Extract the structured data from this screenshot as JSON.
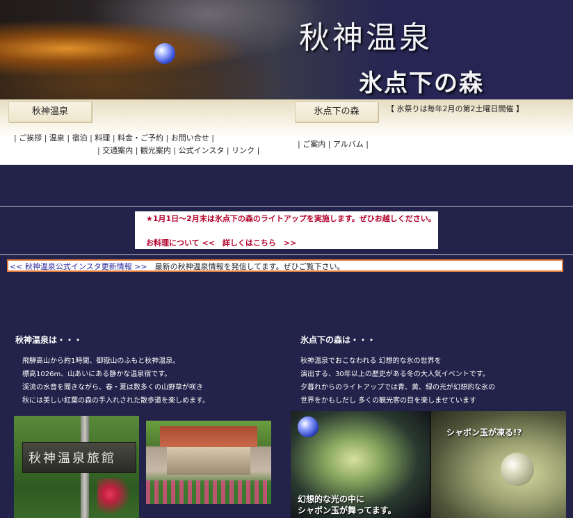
{
  "header": {
    "title_main": "秋神温泉",
    "title_sub": "氷点下の森"
  },
  "nav": {
    "tab_akigami": "秋神温泉",
    "tab_hyoten": "氷点下の森",
    "festival_note": "【 氷祭りは毎年2月の第2土曜日開催 】",
    "akigami_links_row1": [
      "ご挨拶",
      "温泉",
      "宿泊",
      "料理",
      "料金・ご予約",
      "お問い合せ"
    ],
    "akigami_links_row2": [
      "交通案内",
      "観光案内",
      "公式インスタ",
      "リンク"
    ],
    "hyoten_links": [
      "ご案内",
      "アルバム"
    ]
  },
  "notice": {
    "line1": "★1月1日～2月末は氷点下の森のライトアップを実施します。ぜひお越しください。",
    "line2": "お料理について <<　詳しくはこちら　>>"
  },
  "insta": {
    "link": "<< 秋神温泉公式インスタ更新情報 >>",
    "text": "　最新の秋神温泉情報を発信してます。ぜひご覧下さい。"
  },
  "akigami_section": {
    "title": "秋神温泉は・・・",
    "lines": [
      "飛騨高山から約1時間、御嶽山のふもと秋神温泉。",
      "標高1026m、山あいにある静かな温泉宿です。",
      "渓流の水音を聞きながら、春・夏は数多くの山野草が咲き",
      "秋には美しい紅葉の森の手入れされた散歩道を楽しめます。"
    ]
  },
  "hyoten_section": {
    "title": "氷点下の森は・・・",
    "lines": [
      "秋神温泉でおこなわれる 幻想的な氷の世界を",
      "演出する、30年以上の歴史がある冬の大人気イベントです。",
      "夕暮れからのライトアップでは青、黄、緑の光が幻想的な氷の",
      "世界をかもしだし 多くの観光客の目を楽しませています"
    ]
  },
  "photos": {
    "sign_text": "秋神温泉旅館",
    "caption_right": "シャボン玉が凍る!?",
    "caption_left_1": "幻想的な光の中に",
    "caption_left_2": "シャボン玉が舞ってます。"
  },
  "colors": {
    "background": "#23224a",
    "notice_red": "#b2002a",
    "insta_border": "#e07a3a"
  }
}
